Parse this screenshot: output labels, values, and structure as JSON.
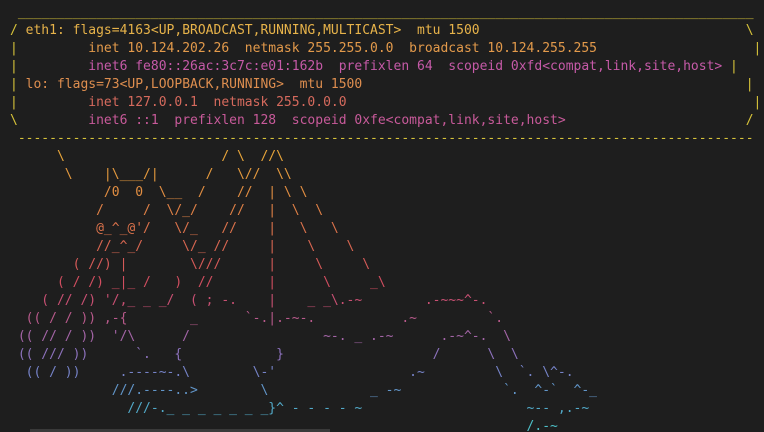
{
  "colors": {
    "background": "#1e1e1e",
    "box_frame": "#d7c33a",
    "cow_gradient_start": "#e8a53a",
    "cow_gradient_mid": "#d24a6a",
    "cow_gradient_end": "#4dc0c8"
  },
  "box": {
    "top_border": " ______________________________________________________________________________________________",
    "line1_frame_left": "/ ",
    "line1_text": "eth1: flags=4163<UP,BROADCAST,RUNNING,MULTICAST>  mtu 1500",
    "line1_frame_right": "                                  \\",
    "line2_frame_left": "|",
    "line2_text": "         inet 10.124.202.26  netmask 255.255.0.0  broadcast 10.124.255.255",
    "line2_frame_right": "                    |",
    "line3_frame_left": "|",
    "line3_text": "         inet6 fe80::26ac:3c7c:e01:162b  prefixlen 64  scopeid 0xfd<compat,link,site,host>",
    "line3_frame_right": " |",
    "line4_frame_left": "| ",
    "line4_text": "lo: flags=73<UP,LOOPBACK,RUNNING>  mtu 1500",
    "line4_frame_right": "                                                 |",
    "line5_frame_left": "|",
    "line5_text": "         inet 127.0.0.1  netmask 255.0.0.0",
    "line5_frame_right": "                                                    |",
    "line6_frame_left": "\\",
    "line6_text": "         inet6 ::1  prefixlen 128  scopeid 0xfe<compat,link,site,host>",
    "line6_frame_right": "                       /",
    "bottom_border": " ----------------------------------------------------------------------------------------------"
  },
  "art_lines": [
    "      \\                    / \\  //\\",
    "       \\    |\\___/|      /   \\//  \\\\",
    "            /0  0  \\__  /    //  | \\ \\",
    "           /     /  \\/_/    //   |  \\  \\",
    "           @_^_@'/   \\/_   //    |   \\   \\",
    "           //_^_/     \\/_ //     |    \\    \\",
    "        ( //) |        \\///      |     \\     \\",
    "      ( / /) _|_ /   )  //       |      \\     _\\",
    "    ( // /) '/,_ _ _/  ( ; -.    |    _ _\\.-~        .-~~~^-.",
    "  (( / / )) ,-{        _      `-.|.-~-.           .~         `.",
    " (( // / ))  '/\\      /                 ~-. _ .-~      .-~^-.  \\",
    " (( /// ))      `.   {            }                   /      \\  \\",
    "  (( / ))     .----~-.\\        \\-'                 .~         \\  `. \\^-.",
    "             ///.----..>        \\             _ -~             `.  ^-`  ^-_",
    "               ///-._ _ _ _ _ _ _}^ - - - - ~                     ~-- ,.-~",
    "                                                                  /.-~"
  ],
  "art_colors": [
    "#e8a53a",
    "#e59a3e",
    "#e28e42",
    "#df8046",
    "#db724b",
    "#d86651",
    "#d55a58",
    "#d24e60",
    "#c95073",
    "#b95a8c",
    "#a465a7",
    "#8d72bd",
    "#7683c8",
    "#6296ca",
    "#52aac9",
    "#4dc0c8"
  ]
}
